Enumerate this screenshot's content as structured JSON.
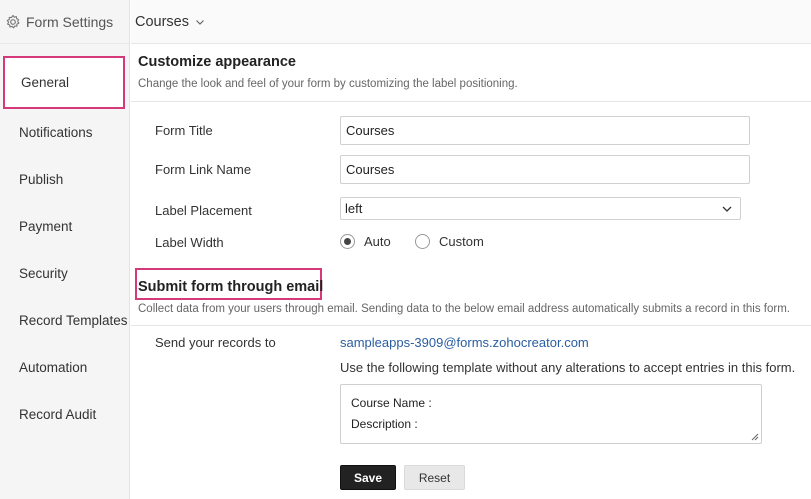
{
  "sidebar": {
    "header": {
      "icon": "gear-icon",
      "title": "Form Settings"
    },
    "items": [
      {
        "label": "General",
        "active": true
      },
      {
        "label": "Notifications"
      },
      {
        "label": "Publish"
      },
      {
        "label": "Payment"
      },
      {
        "label": "Security"
      },
      {
        "label": "Record Templates"
      },
      {
        "label": "Automation"
      },
      {
        "label": "Record Audit"
      }
    ]
  },
  "topbar": {
    "form_name": "Courses",
    "icon": "chevron-down-icon"
  },
  "appearance": {
    "title": "Customize appearance",
    "description": "Change the look and feel of your form by customizing the label positioning.",
    "form_title_label": "Form Title",
    "form_title_value": "Courses",
    "form_link_label": "Form Link Name",
    "form_link_value": "Courses",
    "label_placement_label": "Label Placement",
    "label_placement_value": "left",
    "label_width_label": "Label Width",
    "label_width_options": [
      {
        "label": "Auto",
        "selected": true
      },
      {
        "label": "Custom",
        "selected": false
      }
    ]
  },
  "email": {
    "title": "Submit form through email",
    "description": "Collect data from your users through email. Sending data to the below email address automatically submits a record in this form.",
    "send_label": "Send your records to",
    "address": "sampleapps-3909@forms.zohocreator.com",
    "template_note": "Use the following template without any alterations to accept entries in this form.",
    "template_lines": [
      "Course Name :",
      "Description :"
    ]
  },
  "actions": {
    "save_label": "Save",
    "reset_label": "Reset"
  },
  "colors": {
    "highlight": "#d6397a",
    "link": "#2a5d9f",
    "save_bg": "#222222"
  }
}
